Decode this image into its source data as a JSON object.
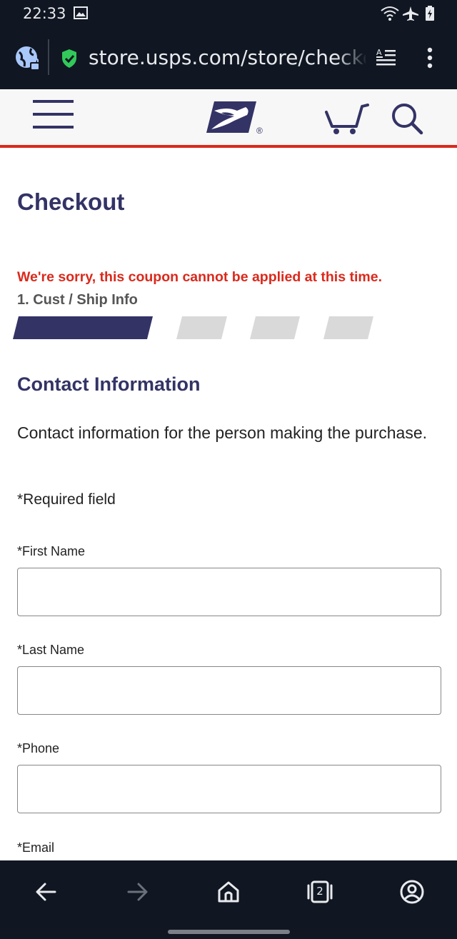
{
  "status_bar": {
    "time": "22:33",
    "icons": [
      "image-notification-icon",
      "wifi-icon",
      "airplane-icon",
      "battery-icon"
    ]
  },
  "browser": {
    "url": "store.usps.com/store/checkout",
    "icons": [
      "site-settings-icon",
      "secure-shield-icon",
      "reader-mode-icon",
      "more-menu-icon"
    ]
  },
  "header": {
    "icons": [
      "hamburger-menu-icon",
      "usps-eagle-logo",
      "cart-icon",
      "search-icon"
    ],
    "logo_mark": "®"
  },
  "page": {
    "title": "Checkout",
    "error_message": "We're sorry, this coupon cannot be applied at this time.",
    "step_label": "1. Cust / Ship Info",
    "progress": {
      "current_step": 1,
      "total_steps": 4
    }
  },
  "contact": {
    "title": "Contact Information",
    "description": "Contact information for the person making the purchase.",
    "required_note": "*Required field",
    "fields": [
      {
        "label": "*First Name",
        "value": ""
      },
      {
        "label": "*Last Name",
        "value": ""
      },
      {
        "label": "*Phone",
        "value": ""
      },
      {
        "label": "*Email",
        "value": ""
      }
    ]
  },
  "nav_bar": {
    "tab_count": "2",
    "icons": [
      "back-arrow-icon",
      "forward-arrow-icon",
      "home-icon",
      "tabs-icon",
      "account-icon"
    ]
  },
  "colors": {
    "usps_blue": "#333366",
    "usps_red": "#da291c",
    "progress_inactive": "#d9d9d9",
    "system_bar": "#101722"
  }
}
